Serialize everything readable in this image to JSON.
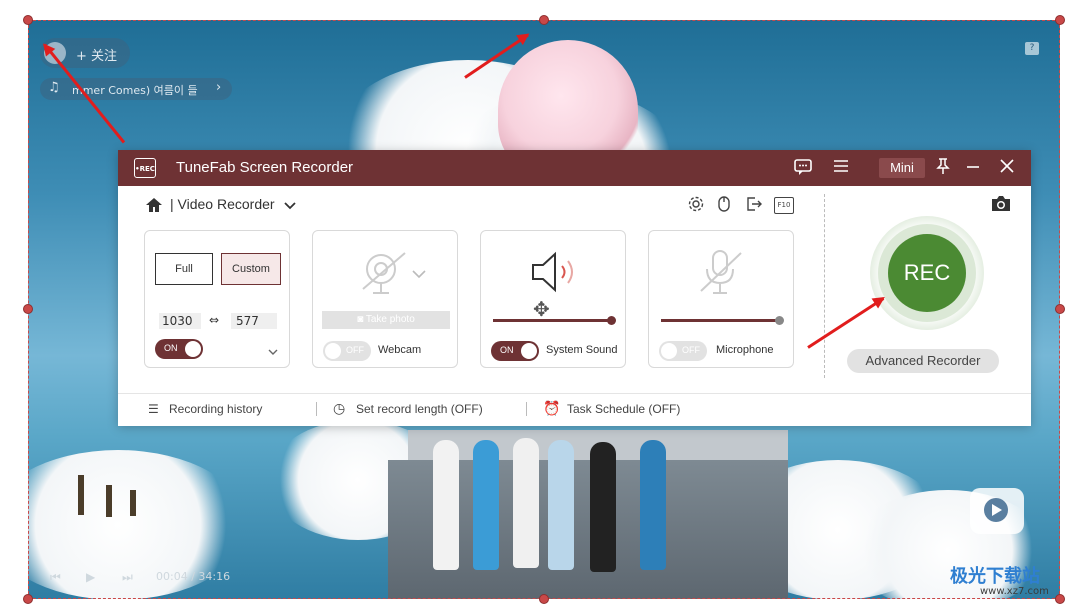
{
  "app": {
    "title": "TuneFab Screen Recorder",
    "logo_text": "•REC",
    "mini_label": "Mini"
  },
  "breadcrumb": {
    "separator": "|",
    "mode": "Video Recorder"
  },
  "toolbar_keys": {
    "hotkey_label": "F10"
  },
  "display_card": {
    "full_label": "Full",
    "custom_label": "Custom",
    "width": "1030",
    "height": "577",
    "toggle": "ON"
  },
  "webcam_card": {
    "take_photo": "Take photo",
    "toggle": "OFF",
    "label": "Webcam"
  },
  "sound_card": {
    "toggle": "ON",
    "label": "System Sound",
    "volume_percent": 100
  },
  "mic_card": {
    "toggle": "OFF",
    "label": "Microphone",
    "volume_percent": 100
  },
  "rec": {
    "label": "REC",
    "advanced": "Advanced Recorder"
  },
  "footer": {
    "history": "Recording history",
    "record_length": "Set record length (OFF)",
    "schedule": "Task Schedule (OFF)"
  },
  "background_video": {
    "follow": "+ 关注",
    "song": "mmer Comes)  여름이 들",
    "time": "00:04 / 34:16",
    "watermark_text": "极光下载站",
    "watermark_url": "www.xz7.com"
  },
  "colors": {
    "titlebar": "#6e3234",
    "toggle_on": "#6e3234",
    "rec_green": "#4b8a33",
    "selection": "#c94848",
    "arrow": "#e11d1d"
  }
}
